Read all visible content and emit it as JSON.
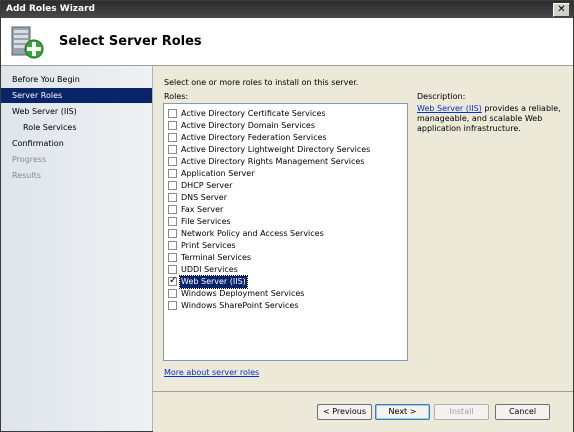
{
  "window": {
    "title": "Add Roles Wizard",
    "close_glyph": "✕"
  },
  "header": {
    "title": "Select Server Roles",
    "icon": "server-add-icon"
  },
  "sidebar": {
    "items": [
      {
        "label": "Before You Begin",
        "state": "normal"
      },
      {
        "label": "Server Roles",
        "state": "active"
      },
      {
        "label": "Web Server (IIS)",
        "state": "normal"
      },
      {
        "label": "Role Services",
        "state": "sub"
      },
      {
        "label": "Confirmation",
        "state": "normal"
      },
      {
        "label": "Progress",
        "state": "disabled"
      },
      {
        "label": "Results",
        "state": "disabled"
      }
    ]
  },
  "main": {
    "instructions": "Select one or more roles to install on this server.",
    "roles_label": "Roles:",
    "roles": [
      {
        "label": "Active Directory Certificate Services",
        "checked": false
      },
      {
        "label": "Active Directory Domain Services",
        "checked": false
      },
      {
        "label": "Active Directory Federation Services",
        "checked": false
      },
      {
        "label": "Active Directory Lightweight Directory Services",
        "checked": false
      },
      {
        "label": "Active Directory Rights Management Services",
        "checked": false
      },
      {
        "label": "Application Server",
        "checked": false
      },
      {
        "label": "DHCP Server",
        "checked": false
      },
      {
        "label": "DNS Server",
        "checked": false
      },
      {
        "label": "Fax Server",
        "checked": false
      },
      {
        "label": "File Services",
        "checked": false
      },
      {
        "label": "Network Policy and Access Services",
        "checked": false
      },
      {
        "label": "Print Services",
        "checked": false
      },
      {
        "label": "Terminal Services",
        "checked": false
      },
      {
        "label": "UDDI Services",
        "checked": false
      },
      {
        "label": "Web Server (IIS)",
        "checked": true
      },
      {
        "label": "Windows Deployment Services",
        "checked": false
      },
      {
        "label": "Windows SharePoint Services",
        "checked": false
      }
    ],
    "more_link": "More about server roles",
    "description": {
      "title": "Description:",
      "link": "Web Server (IIS)",
      "text": " provides a reliable, manageable, and scalable Web application infrastructure."
    }
  },
  "footer": {
    "previous": "< Previous",
    "next": "Next >",
    "install": "Install",
    "cancel": "Cancel"
  }
}
